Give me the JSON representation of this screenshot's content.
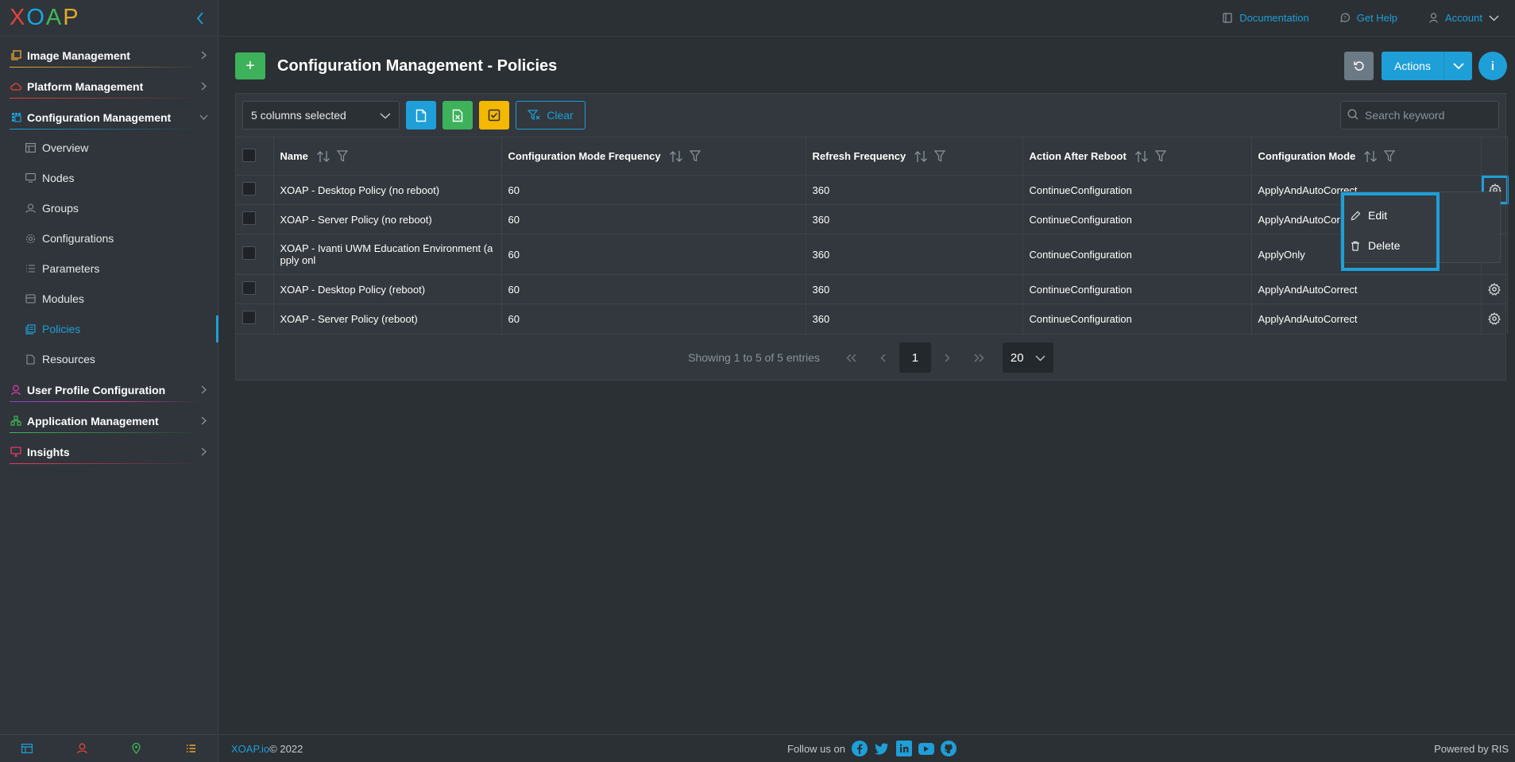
{
  "sidebar": {
    "logo": {
      "letters": [
        "X",
        "O",
        "A",
        "P"
      ],
      "colors": [
        "#e8433a",
        "#19a7e0",
        "#43b757",
        "#e5a92b"
      ]
    },
    "sections": [
      {
        "label": "Image Management",
        "color": "#f0a830",
        "expanded": false
      },
      {
        "label": "Platform Management",
        "color": "#e8433a",
        "expanded": false
      },
      {
        "label": "Configuration Management",
        "color": "#1e9fd8",
        "expanded": true,
        "items": [
          {
            "label": "Overview",
            "icon": "table-icon"
          },
          {
            "label": "Nodes",
            "icon": "monitor-icon"
          },
          {
            "label": "Groups",
            "icon": "group-icon"
          },
          {
            "label": "Configurations",
            "icon": "gear-icon"
          },
          {
            "label": "Parameters",
            "icon": "list-icon"
          },
          {
            "label": "Modules",
            "icon": "module-icon"
          },
          {
            "label": "Policies",
            "icon": "policy-icon",
            "active": true
          },
          {
            "label": "Resources",
            "icon": "file-icon"
          }
        ]
      },
      {
        "label": "User Profile Configuration",
        "color": "#d63ca8",
        "expanded": false
      },
      {
        "label": "Application Management",
        "color": "#43b757",
        "expanded": false
      },
      {
        "label": "Insights",
        "color": "#e83a6a",
        "expanded": false
      }
    ]
  },
  "topbar": {
    "documentation": "Documentation",
    "help": "Get Help",
    "account": "Account"
  },
  "header": {
    "add_label": "+",
    "title": "Configuration Management - Policies",
    "actions_label": "Actions",
    "info_label": "i"
  },
  "toolbar": {
    "columns_selected": "5 columns selected",
    "clear_label": "Clear",
    "search_placeholder": "Search keyword"
  },
  "table": {
    "columns": [
      "Name",
      "Configuration Mode Frequency",
      "Refresh Frequency",
      "Action After Reboot",
      "Configuration Mode"
    ],
    "rows": [
      {
        "name": "XOAP - Desktop Policy (no reboot)",
        "cmf": "60",
        "rf": "360",
        "aar": "ContinueConfiguration",
        "cm": "ApplyAndAutoCorrect"
      },
      {
        "name": "XOAP - Server Policy (no reboot)",
        "cmf": "60",
        "rf": "360",
        "aar": "ContinueConfiguration",
        "cm": "ApplyAndAutoCor"
      },
      {
        "name": "XOAP - Ivanti UWM Education Environment (a pply onl",
        "cmf": "60",
        "rf": "360",
        "aar": "ContinueConfiguration",
        "cm": "ApplyOnly"
      },
      {
        "name": "XOAP - Desktop Policy (reboot)",
        "cmf": "60",
        "rf": "360",
        "aar": "ContinueConfiguration",
        "cm": "ApplyAndAutoCorrect"
      },
      {
        "name": "XOAP - Server Policy (reboot)",
        "cmf": "60",
        "rf": "360",
        "aar": "ContinueConfiguration",
        "cm": "ApplyAndAutoCorrect"
      }
    ]
  },
  "pagination": {
    "info": "Showing 1 to 5 of 5 entries",
    "current_page": "1",
    "page_size": "20"
  },
  "context_menu": {
    "edit": "Edit",
    "delete": "Delete"
  },
  "footer": {
    "brand": "XOAP.io",
    "copyright": " © 2022",
    "follow": "Follow us on",
    "powered": "Powered by RIS"
  },
  "colors": {
    "accent": "#1e9fd8",
    "green": "#3eb15b",
    "yellow": "#f5b800"
  }
}
